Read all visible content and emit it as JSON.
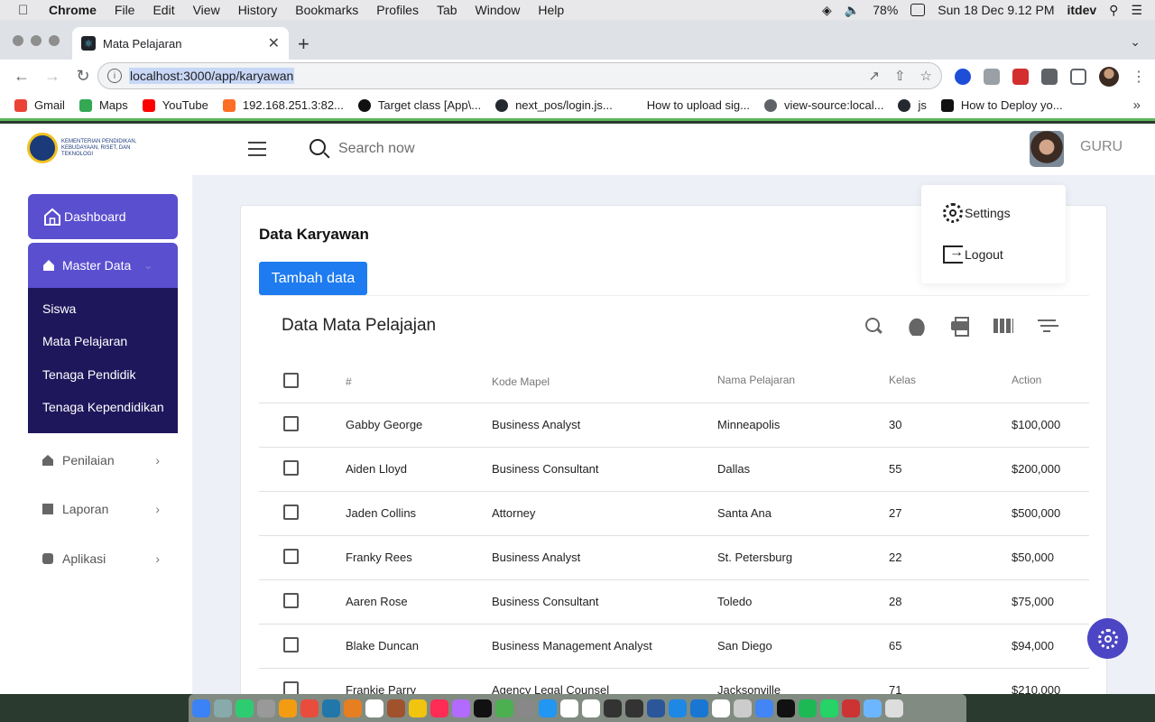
{
  "menubar": {
    "app": "Chrome",
    "items": [
      "File",
      "Edit",
      "View",
      "History",
      "Bookmarks",
      "Profiles",
      "Tab",
      "Window",
      "Help"
    ],
    "battery": "78%",
    "clock": "Sun 18 Dec  9.12 PM",
    "user": "itdev"
  },
  "browser": {
    "tab_title": "Mata Pelajaran",
    "url": "localhost:3000/app/karyawan",
    "bookmarks": [
      {
        "label": "Gmail",
        "color": "#ea4335"
      },
      {
        "label": "Maps",
        "color": "#34a853"
      },
      {
        "label": "YouTube",
        "color": "#ff0000"
      },
      {
        "label": "192.168.251.3:82...",
        "color": "#fc6d26"
      },
      {
        "label": "Target class [App\\...",
        "color": "#111111"
      },
      {
        "label": "next_pos/login.js...",
        "color": "#24292f"
      },
      {
        "label": "How to upload sig...",
        "color": "#ffffff"
      },
      {
        "label": "view-source:local...",
        "color": "#5f6368"
      },
      {
        "label": "js",
        "color": "#24292f"
      },
      {
        "label": "How to Deploy yo...",
        "color": "#111111"
      }
    ]
  },
  "app": {
    "logo_text": "KEMENTERIAN PENDIDIKAN, KEBUDAYAAN, RISET, DAN TEKNOLOGI",
    "search_placeholder": "Search now",
    "role": "GURU",
    "profile_menu": {
      "settings": "Settings",
      "logout": "Logout"
    }
  },
  "sidebar": {
    "dashboard": "Dashboard",
    "master_data": "Master Data",
    "sub_items": [
      "Siswa",
      "Mata Pelajaran",
      "Tenaga Pendidik",
      "Tenaga Kependidikan"
    ],
    "items": [
      "Penilaian",
      "Laporan",
      "Aplikasi"
    ]
  },
  "main": {
    "title": "Data Karyawan",
    "add_button": "Tambah data",
    "table_title": "Data Mata Pelajajan",
    "columns": [
      "#",
      "Kode Mapel",
      "Nama Pelajaran",
      "Kelas",
      "Action"
    ],
    "rows": [
      [
        "Gabby George",
        "Business Analyst",
        "Minneapolis",
        "30",
        "$100,000"
      ],
      [
        "Aiden Lloyd",
        "Business Consultant",
        "Dallas",
        "55",
        "$200,000"
      ],
      [
        "Jaden Collins",
        "Attorney",
        "Santa Ana",
        "27",
        "$500,000"
      ],
      [
        "Franky Rees",
        "Business Analyst",
        "St. Petersburg",
        "22",
        "$50,000"
      ],
      [
        "Aaren Rose",
        "Business Consultant",
        "Toledo",
        "28",
        "$75,000"
      ],
      [
        "Blake Duncan",
        "Business Management Analyst",
        "San Diego",
        "65",
        "$94,000"
      ],
      [
        "Frankie Parry",
        "Agency Legal Counsel",
        "Jacksonville",
        "71",
        "$210,000"
      ]
    ]
  },
  "colors": {
    "primary": "#5a4fcf",
    "sidebar_dark": "#1f175c",
    "button": "#1e7bf0",
    "fab": "#4c45c4"
  }
}
